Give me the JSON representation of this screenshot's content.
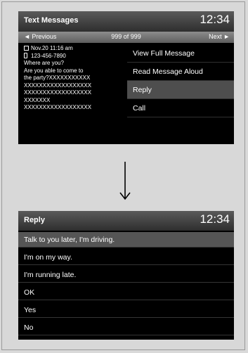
{
  "screen1": {
    "title": "Text Messages",
    "clock": "12:34",
    "nav": {
      "prev": "◄  Previous",
      "count": "999 of 999",
      "next": "Next  ►"
    },
    "message": {
      "datetime": "Nov.20 11:16 am",
      "phone": "123-456-7890",
      "lines": [
        "Where are you?",
        "Are you able to come to",
        "the party?XXXXXXXXXXX",
        "XXXXXXXXXXXXXXXXXX",
        "XXXXXXXXXXXXXXXXXX",
        "XXXXXXX",
        "XXXXXXXXXXXXXXXXXX"
      ]
    },
    "options": [
      "View Full Message",
      "Read Message Aloud",
      "Reply",
      "Call"
    ]
  },
  "screen2": {
    "title": "Reply",
    "clock": "12:34",
    "replies": [
      "Talk to you later, I'm driving.",
      "I'm on my way.",
      "I'm running late.",
      "OK",
      "Yes",
      "No"
    ]
  }
}
